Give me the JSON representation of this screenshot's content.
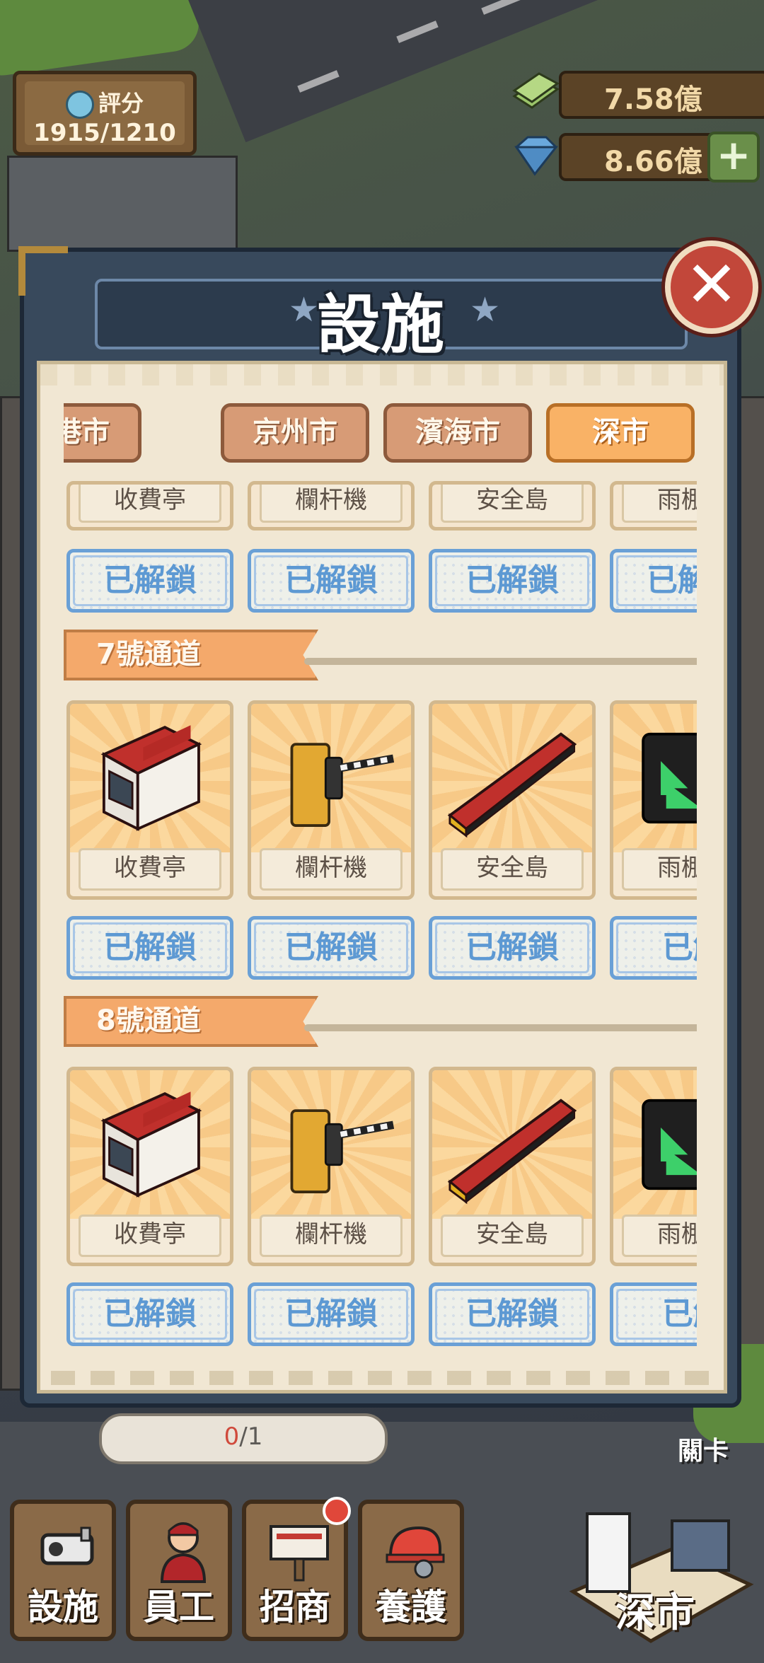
{
  "hud": {
    "score_label": "評分",
    "score_value": "1915/1210",
    "money": "7.58億",
    "gems": "8.66億",
    "add_symbol": "+"
  },
  "modal": {
    "title": "設施",
    "close_symbol": "✕"
  },
  "city_tabs": [
    {
      "label": "津港市",
      "active": false
    },
    {
      "label": "京州市",
      "active": false
    },
    {
      "label": "濱海市",
      "active": false
    },
    {
      "label": "深市",
      "active": true
    }
  ],
  "top_row": {
    "items": [
      "收費亭",
      "欄杆機",
      "安全島",
      "雨棚信"
    ],
    "status": "已解鎖"
  },
  "sections": [
    {
      "title": "7號通道",
      "items": [
        {
          "name": "收費亭",
          "icon": "toll-booth-icon",
          "status": "已解鎖"
        },
        {
          "name": "欄杆機",
          "icon": "barrier-gate-icon",
          "status": "已解鎖"
        },
        {
          "name": "安全島",
          "icon": "safety-island-icon",
          "status": "已解鎖"
        },
        {
          "name": "雨棚信",
          "icon": "canopy-signal-icon",
          "status": "已解"
        }
      ]
    },
    {
      "title": "8號通道",
      "items": [
        {
          "name": "收費亭",
          "icon": "toll-booth-icon",
          "status": "已解鎖"
        },
        {
          "name": "欄杆機",
          "icon": "barrier-gate-icon",
          "status": "已解鎖"
        },
        {
          "name": "安全島",
          "icon": "safety-island-icon",
          "status": "已解鎖"
        },
        {
          "name": "雨棚信",
          "icon": "canopy-signal-icon",
          "status": "已解"
        }
      ]
    }
  ],
  "bottom": {
    "progress_current": "0",
    "progress_total": "/1",
    "stage_label": "關卡",
    "nav": [
      {
        "label": "設施",
        "icon": "camera-icon"
      },
      {
        "label": "員工",
        "icon": "staff-icon"
      },
      {
        "label": "招商",
        "icon": "billboard-icon"
      },
      {
        "label": "養護",
        "icon": "maintenance-icon"
      }
    ],
    "city_label": "深市"
  },
  "colors": {
    "modal_frame": "#38495c",
    "paper": "#f1e7d3",
    "tab_active": "#f9b266",
    "tab_inactive": "#d79b76",
    "unlocked_blue": "#5d99d3",
    "section_orange": "#f4a96b",
    "close_red": "#c2473a"
  }
}
